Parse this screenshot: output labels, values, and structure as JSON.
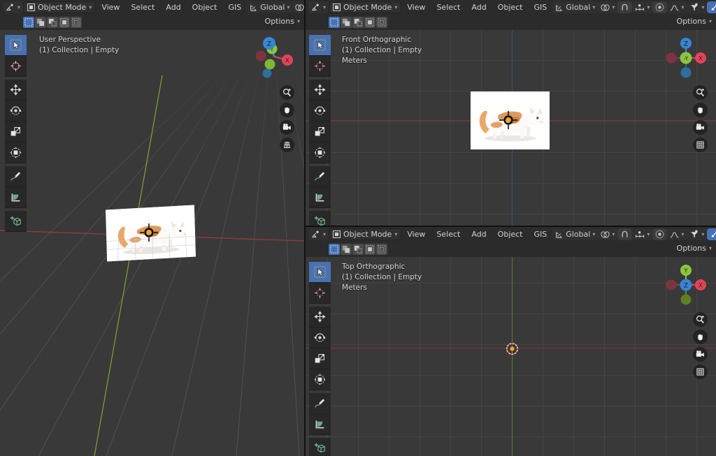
{
  "app": {
    "name": "Blender 3D Viewport",
    "theme_bg": "#393939",
    "header_bg": "#2b2b2b",
    "accent_blue": "#4772b3"
  },
  "header": {
    "mode_label": "Object Mode",
    "menus": [
      "View",
      "Select",
      "Add",
      "Object",
      "GIS"
    ],
    "transform_orientation": "Global",
    "options_label": "Options",
    "icons": {
      "editor_type": "editor-type-icon",
      "mode_box": "object-mode-icon",
      "orientation": "transform-orientation-icon",
      "pivot": "pivot-point-icon",
      "snap_magnet": "snap-magnet-icon",
      "snap_target": "snap-target-icon",
      "proportional": "proportional-editing-icon",
      "falloff": "proportional-falloff-icon",
      "visibility": "object-visibility-icon",
      "gizmo_toggle": "gizmo-toggle-icon",
      "caret": "chevron-down-icon"
    },
    "select_modes": [
      {
        "name": "tweak-select-mode",
        "active": true
      },
      {
        "name": "box-select-mode",
        "active": false
      },
      {
        "name": "circle-select-mode",
        "active": false
      },
      {
        "name": "lasso-select-mode",
        "active": false
      },
      {
        "name": "select-extend-mode",
        "active": false
      }
    ]
  },
  "toolbar": {
    "tools": [
      {
        "name": "tweak-tool",
        "icon": "cursor-arrow-icon",
        "active": true
      },
      {
        "name": "cursor-tool",
        "icon": "3d-cursor-icon",
        "active": false
      },
      {
        "name": "move-tool",
        "icon": "move-arrows-icon",
        "active": false
      },
      {
        "name": "rotate-tool",
        "icon": "rotate-icon",
        "active": false
      },
      {
        "name": "scale-tool",
        "icon": "scale-icon",
        "active": false
      },
      {
        "name": "transform-tool",
        "icon": "transform-icon",
        "active": false
      },
      {
        "name": "annotate-tool",
        "icon": "pencil-icon",
        "active": false
      },
      {
        "name": "measure-tool",
        "icon": "ruler-protractor-icon",
        "active": false
      },
      {
        "name": "add-cube-tool",
        "icon": "add-cube-icon",
        "active": false
      }
    ]
  },
  "nav_buttons": [
    {
      "name": "zoom-nav-button",
      "icon": "magnifier-plus-icon"
    },
    {
      "name": "pan-nav-button",
      "icon": "hand-icon"
    },
    {
      "name": "camera-view-button",
      "icon": "camera-icon"
    },
    {
      "name": "toggle-ortho-button",
      "icon": "grid-perspective-icon"
    }
  ],
  "viewports": [
    {
      "id": "user-perspective",
      "view_name": "User Perspective",
      "collection": "(1) Collection | Empty",
      "units": "",
      "projection": "perspective",
      "gizmo": {
        "center_axis": "",
        "labels": {
          "x": "X",
          "y": "Y",
          "z": "Z"
        },
        "colors": {
          "x": "#e3435a",
          "y": "#8cc63f",
          "z": "#3686d4"
        }
      },
      "has_image_empty": true
    },
    {
      "id": "front-orthographic",
      "view_name": "Front Orthographic",
      "collection": "(1) Collection | Empty",
      "units": "Meters",
      "projection": "orthographic",
      "gizmo": {
        "center_axis": "-Y",
        "labels": {
          "x": "X",
          "y": "-Y",
          "z": "Z"
        },
        "colors": {
          "x": "#e3435a",
          "y": "#8cc63f",
          "z": "#3686d4"
        }
      },
      "has_image_empty": true
    },
    {
      "id": "top-orthographic",
      "view_name": "Top Orthographic",
      "collection": "(1) Collection | Empty",
      "units": "Meters",
      "projection": "orthographic",
      "gizmo": {
        "center_axis": "Z",
        "labels": {
          "x": "X",
          "y": "Y",
          "z": "Z"
        },
        "colors": {
          "x": "#e3435a",
          "y": "#8cc63f",
          "z": "#3686d4"
        }
      },
      "has_image_empty": false
    }
  ],
  "scene_object": {
    "type": "image-empty",
    "subject": "cat-reference-image",
    "selected": true
  },
  "colors": {
    "x_axis_line": "#a23b3b",
    "y_axis_line": "#7a9a3a",
    "z_axis_line": "#3a6a9a",
    "cursor_orange": "#f5a623"
  }
}
